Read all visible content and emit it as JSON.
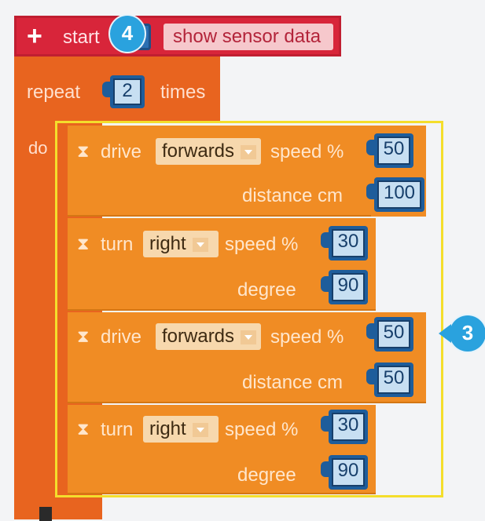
{
  "start_block": {
    "plus": "+",
    "label": "start",
    "action": "show sensor data"
  },
  "badges": {
    "step4": "4",
    "step3": "3"
  },
  "repeat_block": {
    "label": "repeat",
    "count": "2",
    "times": "times",
    "do": "do"
  },
  "commands": [
    {
      "verb": "drive",
      "option": "forwards",
      "param1_label": "speed %",
      "param1_value": "50",
      "param2_label": "distance cm",
      "param2_value": "100"
    },
    {
      "verb": "turn",
      "option": "right",
      "param1_label": "speed %",
      "param1_value": "30",
      "param2_label": "degree",
      "param2_value": "90"
    },
    {
      "verb": "drive",
      "option": "forwards",
      "param1_label": "speed %",
      "param1_value": "50",
      "param2_label": "distance cm",
      "param2_value": "50"
    },
    {
      "verb": "turn",
      "option": "right",
      "param1_label": "speed %",
      "param1_value": "30",
      "param2_label": "degree",
      "param2_value": "90"
    }
  ],
  "icons": {
    "hourglass": "⧗",
    "caret": "chevron-down-icon",
    "plus": "plus-icon"
  },
  "colors": {
    "start": "#d8253a",
    "repeat": "#e8641f",
    "motion": "#f08c24",
    "value_slot": "#1e5d9b",
    "highlight": "#f4de2c",
    "badge": "#2aa2de"
  }
}
